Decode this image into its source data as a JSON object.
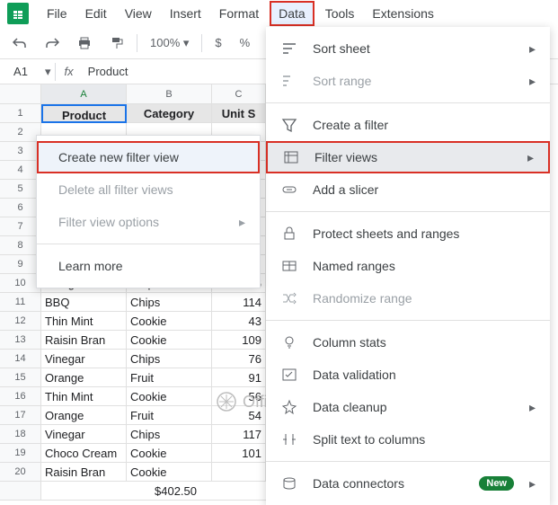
{
  "menubar": [
    "File",
    "Edit",
    "View",
    "Insert",
    "Format",
    "Data",
    "Tools",
    "Extensions"
  ],
  "activeMenuIndex": 5,
  "toolbar": {
    "zoom": "100%",
    "currency": "$",
    "percent": "%"
  },
  "namebox": "A1",
  "formula": "Product",
  "columns": [
    "A",
    "B",
    "C"
  ],
  "headers": [
    "Product",
    "Category",
    "Unit S"
  ],
  "rows": [
    {
      "n": 2,
      "a": "",
      "b": "",
      "c": ""
    },
    {
      "n": 3,
      "a": "",
      "b": "",
      "c": ""
    },
    {
      "n": 4,
      "a": "",
      "b": "",
      "c": ""
    },
    {
      "n": 5,
      "a": "",
      "b": "",
      "c": ""
    },
    {
      "n": 6,
      "a": "",
      "b": "",
      "c": ""
    },
    {
      "n": 7,
      "a": "",
      "b": "",
      "c": ""
    },
    {
      "n": 8,
      "a": "",
      "b": "",
      "c": ""
    },
    {
      "n": 9,
      "a": "",
      "b": "",
      "c": ""
    },
    {
      "n": 10,
      "a": "Vinegar",
      "b": "Chips",
      "c": "116"
    },
    {
      "n": 11,
      "a": "BBQ",
      "b": "Chips",
      "c": "114"
    },
    {
      "n": 12,
      "a": "Thin Mint",
      "b": "Cookie",
      "c": "43"
    },
    {
      "n": 13,
      "a": "Raisin Bran",
      "b": "Cookie",
      "c": "109"
    },
    {
      "n": 14,
      "a": "Vinegar",
      "b": "Chips",
      "c": "76"
    },
    {
      "n": 15,
      "a": "Orange",
      "b": "Fruit",
      "c": "91"
    },
    {
      "n": 16,
      "a": "Thin Mint",
      "b": "Cookie",
      "c": "56"
    },
    {
      "n": 17,
      "a": "Orange",
      "b": "Fruit",
      "c": "54"
    },
    {
      "n": 18,
      "a": "Vinegar",
      "b": "Chips",
      "c": "117"
    },
    {
      "n": 19,
      "a": "Choco Cream",
      "b": "Cookie",
      "c": "101"
    },
    {
      "n": 20,
      "a": "Raisin Bran",
      "b": "Cookie",
      "c": ""
    }
  ],
  "extraCell": "$402.50",
  "dataMenu": {
    "sortSheet": "Sort sheet",
    "sortRange": "Sort range",
    "createFilter": "Create a filter",
    "filterViews": "Filter views",
    "addSlicer": "Add a slicer",
    "protect": "Protect sheets and ranges",
    "namedRanges": "Named ranges",
    "randomize": "Randomize range",
    "columnStats": "Column stats",
    "validation": "Data validation",
    "cleanup": "Data cleanup",
    "splitText": "Split text to columns",
    "connectors": "Data connectors",
    "newBadge": "New"
  },
  "submenu": {
    "create": "Create new filter view",
    "deleteAll": "Delete all filter views",
    "options": "Filter view options",
    "learn": "Learn more"
  },
  "watermark": "OfficeWheel"
}
